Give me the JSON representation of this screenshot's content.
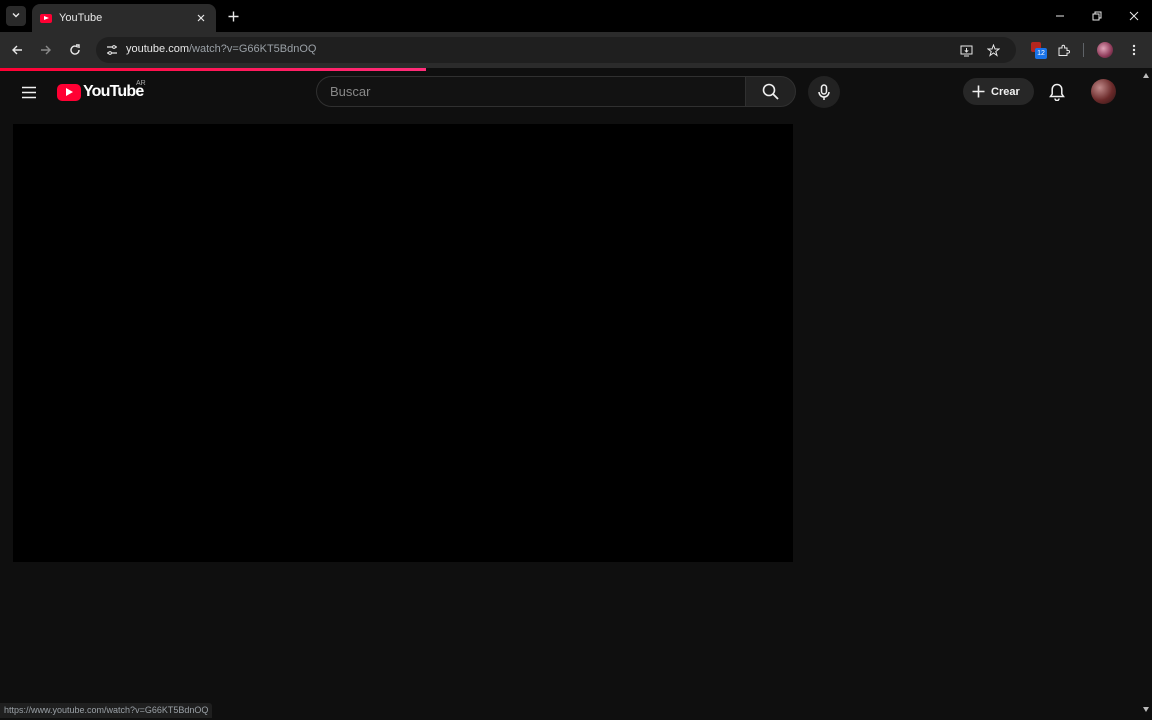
{
  "browser": {
    "tab_title": "YouTube",
    "url_host": "youtube.com",
    "url_path": "/watch?v=G66KT5BdnOQ",
    "extension_badge": "12",
    "status_url": "https://www.youtube.com/watch?v=G66KT5BdnOQ",
    "load_progress": 0.37
  },
  "youtube": {
    "logo_text": "YouTube",
    "country_code": "AR",
    "search_placeholder": "Buscar",
    "search_value": "",
    "create_label": "Crear"
  },
  "colors": {
    "brand_red": "#ff0033",
    "background": "#0f0f0f",
    "player": "#000000"
  },
  "icons": [
    "tab-search-icon",
    "youtube-favicon-icon",
    "close-icon",
    "plus-icon",
    "minimize-icon",
    "restore-icon",
    "window-close-icon",
    "back-icon",
    "forward-icon",
    "reload-icon",
    "site-info-icon",
    "install-app-icon",
    "star-icon",
    "extensions-icon",
    "kebab-menu-icon",
    "hamburger-menu-icon",
    "search-icon",
    "microphone-icon",
    "bell-icon"
  ]
}
